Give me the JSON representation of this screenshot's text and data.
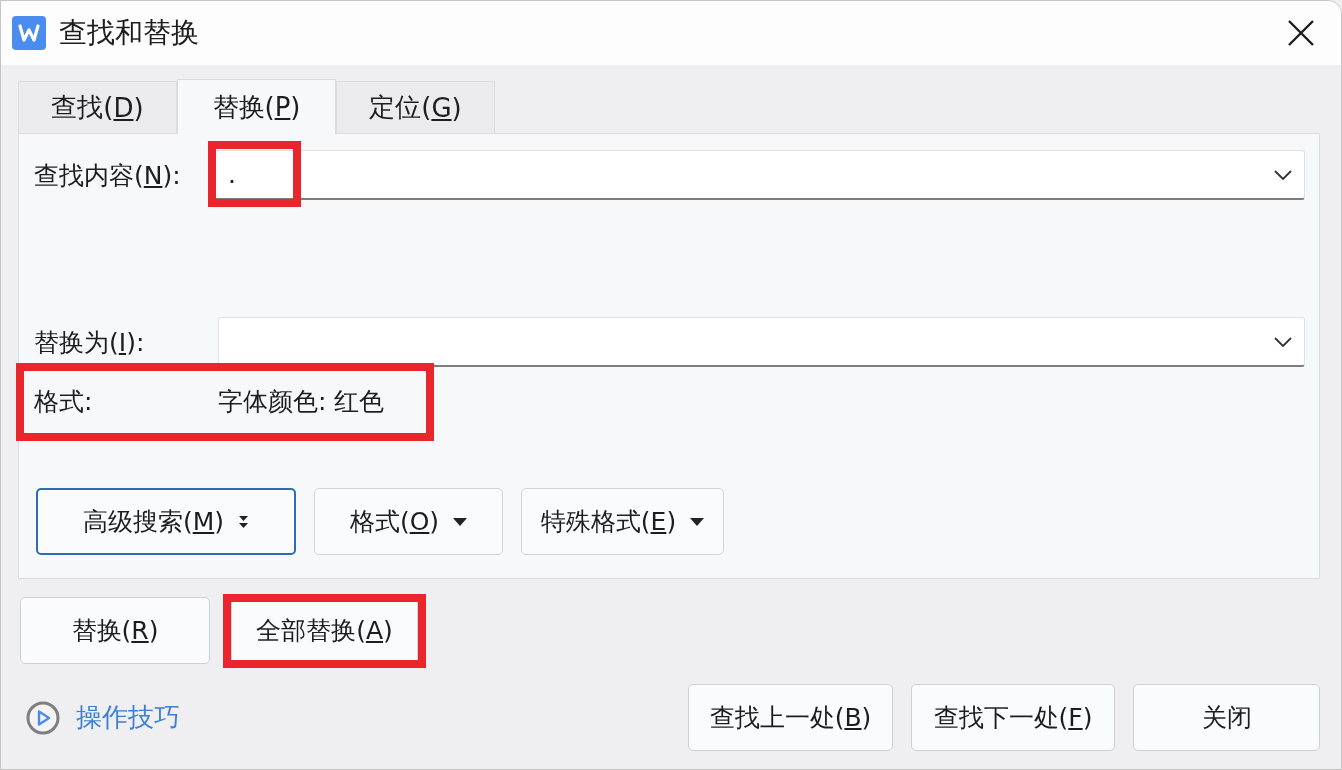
{
  "window": {
    "title": "查找和替换"
  },
  "tabs": [
    {
      "label": "查找(",
      "access_key": "D",
      "label_end": ")",
      "selected": false
    },
    {
      "label": "替换(",
      "access_key": "P",
      "label_end": ")",
      "selected": true
    },
    {
      "label": "定位(",
      "access_key": "G",
      "label_end": ")",
      "selected": false
    }
  ],
  "find": {
    "label": "查找内容(",
    "access_key": "N",
    "label_end": "):",
    "value": ".",
    "highlighted": true
  },
  "replace": {
    "label": "替换为(",
    "access_key": "I",
    "label_end": "):"
  },
  "format_line": {
    "label": "格式:",
    "value": "字体颜色: 红色",
    "highlighted": true
  },
  "option_buttons": [
    {
      "label": "高级搜索(",
      "access_key": "M",
      "label_end": ")",
      "kind": "expander",
      "focused": true
    },
    {
      "label": "格式(",
      "access_key": "O",
      "label_end": ")",
      "kind": "dropdown",
      "focused": false
    },
    {
      "label": "特殊格式(",
      "access_key": "E",
      "label_end": ")",
      "kind": "dropdown",
      "focused": false
    }
  ],
  "action_buttons": [
    {
      "label": "替换(",
      "access_key": "R",
      "label_end": ")",
      "highlighted": false
    },
    {
      "label": "全部替换(",
      "access_key": "A",
      "label_end": ")",
      "highlighted": true
    }
  ],
  "tips_link": {
    "label": "操作技巧"
  },
  "footer_buttons": [
    {
      "label": "查找上一处(",
      "access_key": "B",
      "label_end": ")"
    },
    {
      "label": "查找下一处(",
      "access_key": "F",
      "label_end": ")"
    },
    {
      "label": "关闭"
    }
  ]
}
